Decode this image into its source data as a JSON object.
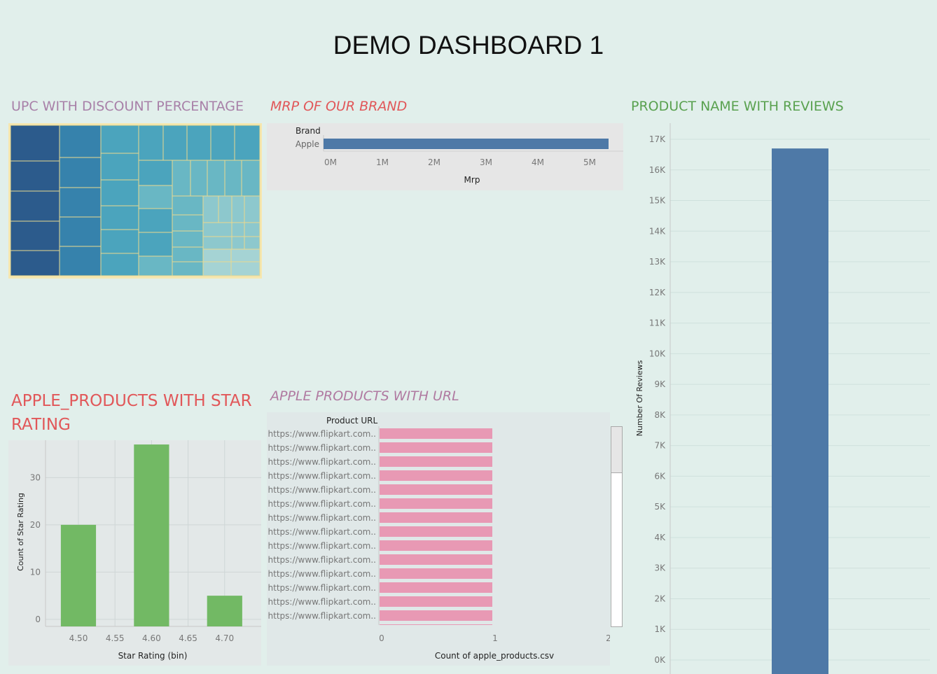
{
  "dashboard": {
    "title": "DEMO DASHBOARD 1"
  },
  "sheets": {
    "treemap_title": "UPC WITH DISCOUNT PERCENTAGE",
    "mrp_title": "MRP OF OUR BRAND",
    "reviews_title": "PRODUCT NAME WITH REVIEWS",
    "rating_title_line1": "APPLE_PRODUCTS WITH STAR",
    "rating_title_line2": "RATING",
    "url_title": "APPLE PRODUCTS WITH URL"
  },
  "colors": {
    "background": "#e1efeb",
    "treemap_title": "#a880a8",
    "mrp_title": "#e15759",
    "reviews_title": "#59a14f",
    "rating_title": "#e15759",
    "url_title": "#b07aa1",
    "bar_blue": "#4e79a7",
    "bar_green": "#72b964",
    "bar_pink": "#e899b4"
  },
  "chart_data": [
    {
      "type": "heatmap",
      "subtype": "treemap",
      "title": "UPC WITH DISCOUNT PERCENTAGE",
      "color_scale": [
        "#2c5b8c",
        "#3682ac",
        "#4ba4bd",
        "#69b7c4",
        "#8dc8cd",
        "#a5d3d4"
      ],
      "cell_count_by_shade": [
        5,
        4,
        4,
        9,
        17,
        22
      ]
    },
    {
      "type": "bar",
      "orientation": "horizontal",
      "title": "MRP OF OUR BRAND",
      "row_header": "Brand",
      "categories": [
        "Apple"
      ],
      "values": [
        5500000
      ],
      "xlabel": "Mrp",
      "xlim": [
        0,
        5500000
      ],
      "ticks": [
        {
          "v": 0,
          "label": "0M"
        },
        {
          "v": 1000000,
          "label": "1M"
        },
        {
          "v": 2000000,
          "label": "2M"
        },
        {
          "v": 3000000,
          "label": "3M"
        },
        {
          "v": 4000000,
          "label": "4M"
        },
        {
          "v": 5000000,
          "label": "5M"
        }
      ]
    },
    {
      "type": "bar",
      "title": "PRODUCT NAME WITH REVIEWS",
      "categories": [
        ""
      ],
      "values": [
        16700
      ],
      "ylabel": "Number Of Reviews",
      "ylim": [
        0,
        17000
      ],
      "ticks": [
        {
          "v": 0,
          "label": "0K"
        },
        {
          "v": 1000,
          "label": "1K"
        },
        {
          "v": 2000,
          "label": "2K"
        },
        {
          "v": 3000,
          "label": "3K"
        },
        {
          "v": 4000,
          "label": "4K"
        },
        {
          "v": 5000,
          "label": "5K"
        },
        {
          "v": 6000,
          "label": "6K"
        },
        {
          "v": 7000,
          "label": "7K"
        },
        {
          "v": 8000,
          "label": "8K"
        },
        {
          "v": 9000,
          "label": "9K"
        },
        {
          "v": 10000,
          "label": "10K"
        },
        {
          "v": 11000,
          "label": "11K"
        },
        {
          "v": 12000,
          "label": "12K"
        },
        {
          "v": 13000,
          "label": "13K"
        },
        {
          "v": 14000,
          "label": "14K"
        },
        {
          "v": 15000,
          "label": "15K"
        },
        {
          "v": 16000,
          "label": "16K"
        },
        {
          "v": 17000,
          "label": "17K"
        }
      ]
    },
    {
      "type": "bar",
      "title": "APPLE_PRODUCTS WITH STAR RATING",
      "xlabel": "Star Rating (bin)",
      "ylabel": "Count of Star Rating",
      "bars": [
        {
          "x": 4.5,
          "value": 20
        },
        {
          "x": 4.6,
          "value": 37
        },
        {
          "x": 4.7,
          "value": 5
        }
      ],
      "bin_width": 0.05,
      "xlim": [
        4.455,
        4.75
      ],
      "ylim": [
        -1.5,
        37.9
      ],
      "xticks": [
        {
          "v": 4.5,
          "label": "4.50"
        },
        {
          "v": 4.55,
          "label": "4.55"
        },
        {
          "v": 4.6,
          "label": "4.60"
        },
        {
          "v": 4.65,
          "label": "4.65"
        },
        {
          "v": 4.7,
          "label": "4.70"
        }
      ],
      "yticks": [
        {
          "v": 0,
          "label": "0"
        },
        {
          "v": 10,
          "label": "10"
        },
        {
          "v": 20,
          "label": "20"
        },
        {
          "v": 30,
          "label": "30"
        }
      ]
    },
    {
      "type": "bar",
      "orientation": "horizontal",
      "title": "APPLE PRODUCTS WITH URL",
      "row_header": "Product URL",
      "categories": [
        "https://www.flipkart.com..",
        "https://www.flipkart.com..",
        "https://www.flipkart.com..",
        "https://www.flipkart.com..",
        "https://www.flipkart.com..",
        "https://www.flipkart.com..",
        "https://www.flipkart.com..",
        "https://www.flipkart.com..",
        "https://www.flipkart.com..",
        "https://www.flipkart.com..",
        "https://www.flipkart.com..",
        "https://www.flipkart.com..",
        "https://www.flipkart.com..",
        "https://www.flipkart.com..",
        "https://www.flipkart.com.."
      ],
      "values": [
        1,
        1,
        1,
        1,
        1,
        1,
        1,
        1,
        1,
        1,
        1,
        1,
        1,
        1,
        1
      ],
      "xlabel": "Count of apple_products.csv",
      "xlim": [
        0,
        2
      ],
      "ticks": [
        {
          "v": 0,
          "label": "0"
        },
        {
          "v": 1,
          "label": "1"
        },
        {
          "v": 2,
          "label": "2"
        }
      ]
    }
  ]
}
